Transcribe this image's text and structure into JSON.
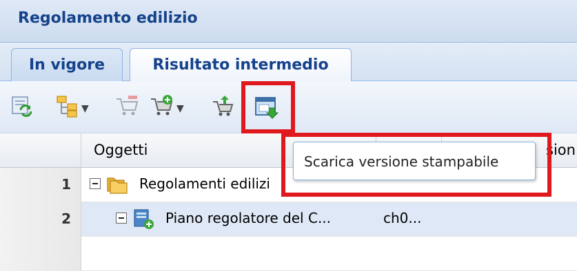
{
  "panel": {
    "title": "Regolamento edilizio"
  },
  "tabs": [
    {
      "label": "In vigore",
      "active": false
    },
    {
      "label": "Risultato intermedio",
      "active": true
    }
  ],
  "toolbar": {
    "buttons": [
      {
        "icon": "refresh-icon"
      },
      {
        "icon": "tree-hierarchy-icon",
        "dropdown": true
      },
      {
        "icon": "cart-remove-icon"
      },
      {
        "icon": "cart-add-icon",
        "dropdown": true
      },
      {
        "icon": "cart-transfer-icon"
      },
      {
        "icon": "download-printable-icon",
        "highlighted": true
      }
    ]
  },
  "tooltip": {
    "text": "Scarica versione stampabile"
  },
  "grid": {
    "columns": [
      "Oggetti",
      "sion"
    ],
    "rows": [
      {
        "num": "1",
        "name": "Regolamenti edilizi",
        "value": ""
      },
      {
        "num": "2",
        "name": "Piano regolatore del C...",
        "value": "ch0..."
      }
    ]
  },
  "colors": {
    "highlight": "#e0191f",
    "title": "#15428b"
  }
}
